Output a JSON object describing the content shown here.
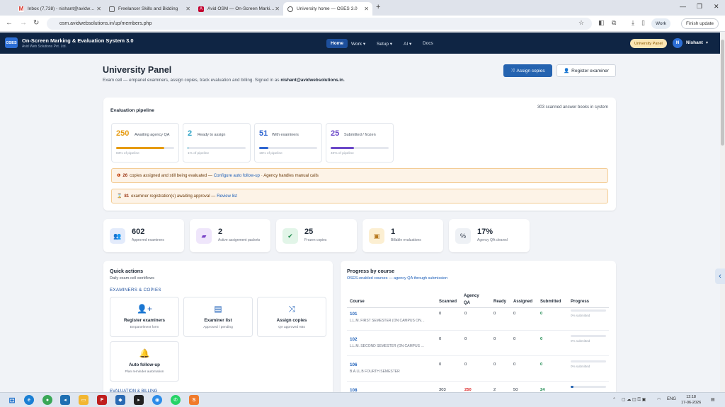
{
  "browser": {
    "tabs": [
      {
        "title": "Inbox (7,738) - nishant@avidw…",
        "icon": "gmail-icon"
      },
      {
        "title": "Freelancer Skills and Bidding",
        "icon": "page-icon"
      },
      {
        "title": "Avid OSM — On-Screen Marki…",
        "icon": "angular-icon"
      },
      {
        "title": "University home — OSES 3.0",
        "icon": "globe-icon"
      }
    ],
    "url": "osm.avidwebsolutions.in/up/members.php",
    "profile_label": "Work",
    "update_label": "Finish update"
  },
  "app": {
    "logo": "OSES",
    "title": "On-Screen Marking & Evaluation System 3.0",
    "subtitle": "Avid Web Solutions Pvt. Ltd.",
    "nav": [
      "Home",
      "Work",
      "Setup",
      "AI",
      "Docs"
    ],
    "panel_badge": "University Panel",
    "user_initial": "N",
    "user_name": "Nishant"
  },
  "header": {
    "title": "University Panel",
    "description": "Exam cell — empanel examiners, assign copies, track evaluation and billing. Signed in as",
    "email": "nishant@avidwebsolutions.in.",
    "assign_button": "Assign copies",
    "register_button": "Register examiner"
  },
  "pipeline": {
    "title": "Evaluation pipeline",
    "total": "303 scanned answer books in system",
    "stages": [
      {
        "value": "250",
        "label": "Awaiting agency QA",
        "pct_text": "83% of pipeline",
        "pct": 0.83,
        "color": "#e69b12"
      },
      {
        "value": "2",
        "label": "Ready to assign",
        "pct_text": "1% of pipeline",
        "pct": 0.01,
        "color": "#2aa2c6"
      },
      {
        "value": "51",
        "label": "With examiners",
        "pct_text": "16% of pipeline",
        "pct": 0.16,
        "color": "#2f66d0"
      },
      {
        "value": "25",
        "label": "Submitted / frozen",
        "pct_text": "40% of pipeline",
        "pct": 0.4,
        "color": "#6b48c8"
      }
    ],
    "alert_assigned": {
      "count": "26",
      "text": "copies assigned and still being evaluated —",
      "link": "Configure auto follow-up",
      "tail": "· Agency handles manual calls"
    },
    "alert_regs": {
      "count": "81",
      "text": "examiner registration(s) awaiting approval —",
      "link": "Review list"
    }
  },
  "stats": [
    {
      "value": "602",
      "label": "Approved examiners",
      "icon": "users-icon",
      "bg": "#e3ebfb",
      "fg": "#2f5fc8"
    },
    {
      "value": "2",
      "label": "Active assignment packets",
      "icon": "folder-icon",
      "bg": "#efe6fb",
      "fg": "#7b46c8"
    },
    {
      "value": "25",
      "label": "Frozen copies",
      "icon": "check-circle-icon",
      "bg": "#e2f5e8",
      "fg": "#1f8a4c"
    },
    {
      "value": "1",
      "label": "Billable evaluations",
      "icon": "money-icon",
      "bg": "#fcefd2",
      "fg": "#b7791f"
    },
    {
      "value": "17%",
      "label": "Agency QA cleared",
      "icon": "percent-icon",
      "bg": "#eef1f5",
      "fg": "#374151"
    }
  ],
  "quick_actions": {
    "title": "Quick actions",
    "subtitle": "Daily exam-cell workflows",
    "section": "EXAMINERS & COPIES",
    "section2": "EVALUATION & BILLING",
    "items": [
      {
        "title": "Register examiners",
        "sub": "Empanelment form",
        "icon": "user-plus-icon",
        "glyph": "👤+"
      },
      {
        "title": "Examiner list",
        "sub": "Approved / pending",
        "icon": "list-icon",
        "glyph": "▤"
      },
      {
        "title": "Assign copies",
        "sub": "QA approved ABs",
        "icon": "shuffle-icon",
        "glyph": "⤨"
      },
      {
        "title": "Auto follow-up",
        "sub": "Plan reminder automation",
        "icon": "bell-icon",
        "glyph": "🔔"
      }
    ]
  },
  "progress": {
    "title": "Progress by course",
    "subtitle": "OSES-enabled courses — agency QA through submission",
    "columns": [
      "Course",
      "Scanned",
      "Agency QA",
      "Ready",
      "Assigned",
      "Submitted",
      "Progress"
    ],
    "rows": [
      {
        "code": "101",
        "name": "L.L.M. FIRST SEMESTER (ON CAMPUS ON…",
        "scanned": "0",
        "qa": "0",
        "ready": "0",
        "assigned": "0",
        "submitted": "0",
        "progress_text": "0% submitted",
        "progress": 0
      },
      {
        "code": "102",
        "name": "L.L.M. SECOND SEMESTER (ON CAMPUS …",
        "scanned": "0",
        "qa": "0",
        "ready": "0",
        "assigned": "0",
        "submitted": "0",
        "progress_text": "0% submitted",
        "progress": 0
      },
      {
        "code": "106",
        "name": "B.A.LL.B FOURTH SEMESTER",
        "scanned": "0",
        "qa": "0",
        "ready": "0",
        "assigned": "0",
        "submitted": "0",
        "progress_text": "0% submitted",
        "progress": 0
      },
      {
        "code": "108",
        "name": "",
        "scanned": "303",
        "qa": "250",
        "ready": "2",
        "assigned": "50",
        "submitted": "24",
        "progress_text": "",
        "progress": 0.08
      }
    ]
  },
  "taskbar": {
    "lang": "ENG",
    "time": "12:18",
    "date": "17-06-2026"
  }
}
